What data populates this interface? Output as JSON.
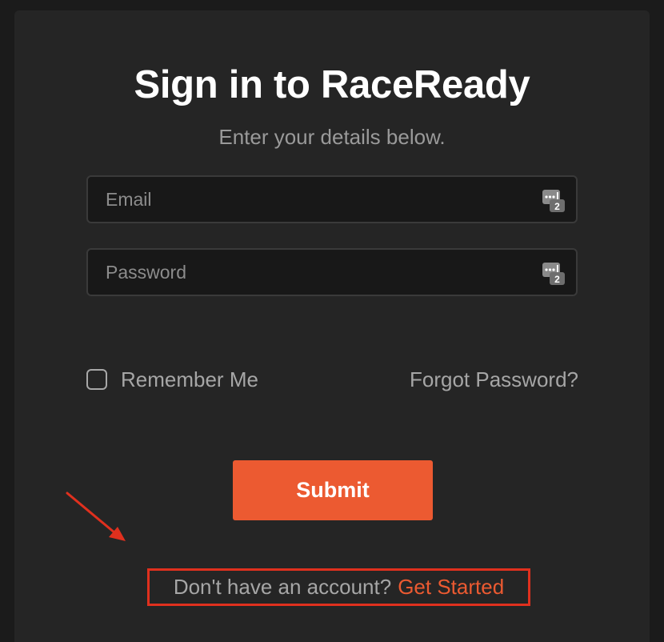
{
  "login": {
    "title": "Sign in to RaceReady",
    "subtitle": "Enter your details below.",
    "email": {
      "placeholder": "Email",
      "value": ""
    },
    "password": {
      "placeholder": "Password",
      "value": ""
    },
    "remember_label": "Remember Me",
    "forgot_label": "Forgot Password?",
    "submit_label": "Submit",
    "signup_prompt": "Don't have an account?",
    "signup_link": "Get Started"
  },
  "colors": {
    "background": "#1b1b1b",
    "card": "#252525",
    "accent": "#ec5a31",
    "annotation": "#e0301e"
  },
  "icons": {
    "field_icon": "password-manager-icon",
    "annotation": "red-arrow-icon"
  }
}
